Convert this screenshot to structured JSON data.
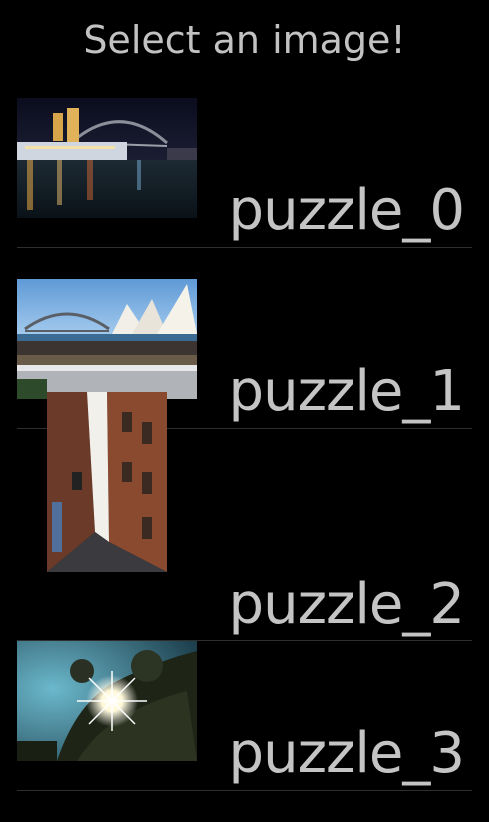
{
  "header": {
    "title": "Select an image!"
  },
  "images": [
    {
      "label": "puzzle_0",
      "thumbnail_icon": "harbour-bridge-night-photo"
    },
    {
      "label": "puzzle_1",
      "thumbnail_icon": "opera-house-bridge-photo"
    },
    {
      "label": "puzzle_2",
      "thumbnail_icon": "brick-alley-photo"
    },
    {
      "label": "puzzle_3",
      "thumbnail_icon": "sunburst-tree-photo"
    }
  ],
  "colors": {
    "background": "#000000",
    "text": "#c4c4c4",
    "divider": "#2e2e2e"
  }
}
